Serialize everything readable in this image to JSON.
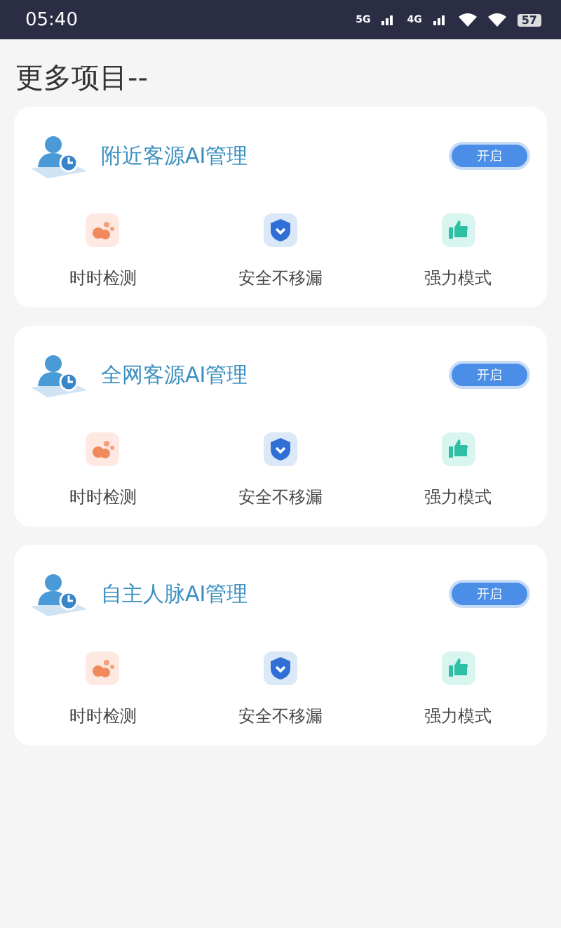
{
  "status_bar": {
    "time": "05:40",
    "networks": [
      "5G",
      "4G"
    ],
    "battery": "57"
  },
  "page_title": "更多项目--",
  "cards": [
    {
      "title": "附近客源AI管理",
      "button": "开启",
      "features": [
        {
          "kind": "paw",
          "label": "时时检测"
        },
        {
          "kind": "shield",
          "label": "安全不移漏"
        },
        {
          "kind": "thumb",
          "label": "强力模式"
        }
      ]
    },
    {
      "title": "全网客源AI管理",
      "button": "开启",
      "features": [
        {
          "kind": "paw",
          "label": "时时检测"
        },
        {
          "kind": "shield",
          "label": "安全不移漏"
        },
        {
          "kind": "thumb",
          "label": "强力模式"
        }
      ]
    },
    {
      "title": "自主人脉AI管理",
      "button": "开启",
      "features": [
        {
          "kind": "paw",
          "label": "时时检测"
        },
        {
          "kind": "shield",
          "label": "安全不移漏"
        },
        {
          "kind": "thumb",
          "label": "强力模式"
        }
      ]
    }
  ]
}
